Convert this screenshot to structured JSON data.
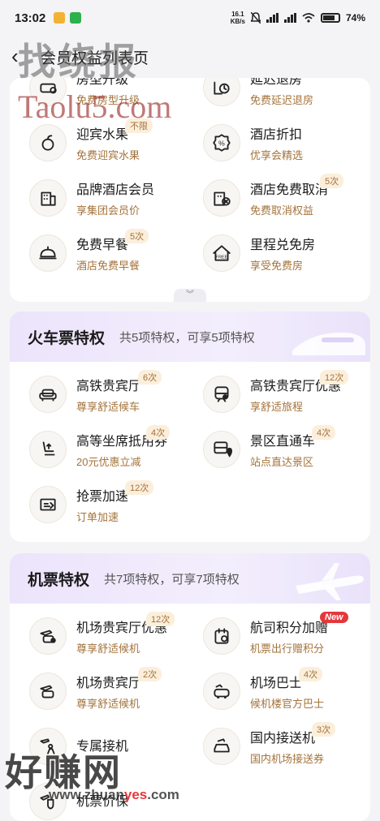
{
  "status": {
    "time": "13:02",
    "net_speed": "16.1",
    "net_unit": "KB/s",
    "battery": "74%"
  },
  "nav": {
    "title": "会员权益列表页"
  },
  "hotel": {
    "items": [
      {
        "name": "房型升级",
        "desc": "免费房型升级",
        "badge": "",
        "icon": "bed-upgrade-icon"
      },
      {
        "name": "延迟退房",
        "desc": "免费延迟退房",
        "badge": "",
        "icon": "late-checkout-icon"
      },
      {
        "name": "迎宾水果",
        "desc": "免费迎宾水果",
        "badge": "不限",
        "icon": "fruit-icon"
      },
      {
        "name": "酒店折扣",
        "desc": "优享会精选",
        "badge": "",
        "icon": "discount-icon"
      },
      {
        "name": "品牌酒店会员",
        "desc": "享集团会员价",
        "badge": "",
        "icon": "brand-hotel-icon"
      },
      {
        "name": "酒店免费取消",
        "desc": "免费取消权益",
        "badge": "5次",
        "icon": "hotel-cancel-icon"
      },
      {
        "name": "免费早餐",
        "desc": "酒店免费早餐",
        "badge": "5次",
        "icon": "breakfast-icon"
      },
      {
        "name": "里程兑免房",
        "desc": "享受免费房",
        "badge": "",
        "icon": "mileage-room-icon"
      }
    ]
  },
  "train": {
    "title": "火车票特权",
    "subtitle": "共5项特权，可享5项特权",
    "items": [
      {
        "name": "高铁贵宾厅",
        "desc": "尊享舒适候车",
        "badge": "6次",
        "icon": "sofa-icon"
      },
      {
        "name": "高铁贵宾厅优惠",
        "desc": "享舒适旅程",
        "badge": "12次",
        "icon": "train-discount-icon"
      },
      {
        "name": "高等坐席抵用券",
        "desc": "20元优惠立减",
        "badge": "4次",
        "icon": "seat-upgrade-icon"
      },
      {
        "name": "景区直通车",
        "desc": "站点直达景区",
        "badge": "4次",
        "icon": "bus-location-icon"
      },
      {
        "name": "抢票加速",
        "desc": "订单加速",
        "badge": "12次",
        "icon": "ticket-speed-icon"
      }
    ]
  },
  "flight": {
    "title": "机票特权",
    "subtitle": "共7项特权，可享7项特权",
    "items": [
      {
        "name": "机场贵宾厅优惠",
        "desc": "尊享舒适候机",
        "badge": "12次",
        "icon": "plane-lounge-discount-icon"
      },
      {
        "name": "航司积分加赠",
        "desc": "机票出行赠积分",
        "badge": "New",
        "icon": "airline-points-icon"
      },
      {
        "name": "机场贵宾厅",
        "desc": "尊享舒适候机",
        "badge": "2次",
        "icon": "plane-lounge-icon"
      },
      {
        "name": "机场巴士",
        "desc": "候机楼官方巴士",
        "badge": "4次",
        "icon": "airport-bus-icon"
      },
      {
        "name": "专属接机",
        "desc": "",
        "badge": "",
        "icon": "pickup-icon"
      },
      {
        "name": "国内接送机",
        "desc": "国内机场接送券",
        "badge": "3次",
        "icon": "car-transfer-icon"
      },
      {
        "name": "机票价保",
        "desc": "",
        "badge": "",
        "icon": "price-protect-icon"
      }
    ]
  },
  "watermarks": {
    "top": "找绕报",
    "top2": "Taolu5.com",
    "bottom": "好赚网",
    "url_a": "www.zhuan",
    "url_b": "yes",
    "url_c": ".com"
  },
  "colors": {
    "accent": "#a4733b",
    "badge_bg": "#fbefdc",
    "header_bg": "#ece4fb",
    "new_badge": "#e5383b"
  }
}
